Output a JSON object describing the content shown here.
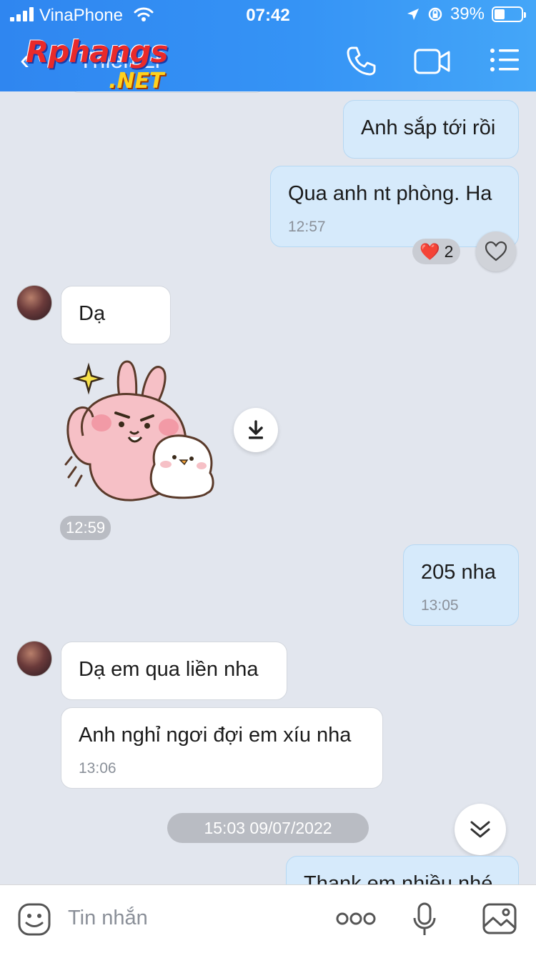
{
  "status_bar": {
    "carrier": "VinaPhone",
    "time": "07:42",
    "battery_percent": "39%",
    "battery_level": 0.39
  },
  "header": {
    "title": "Thiên Li",
    "logo_main": "Rphangs",
    "logo_sub": ".NET",
    "back_icon": "back-arrow-icon",
    "call_icon": "phone-icon",
    "video_icon": "video-camera-icon",
    "menu_icon": "menu-list-icon"
  },
  "messages": {
    "m1": {
      "text": "Anh sắp tới rồi"
    },
    "m2": {
      "text": "Qua anh nt phòng. Ha",
      "time": "12:57",
      "reaction_count": "2",
      "reaction_emoji": "❤️"
    },
    "m3": {
      "text": "Dạ"
    },
    "sticker_time": "12:59",
    "m4": {
      "text": "205 nha",
      "time": "13:05"
    },
    "m5": {
      "text": "Dạ em qua liền nha"
    },
    "m6": {
      "text": "Anh nghỉ ngơi đợi em xíu nha",
      "time": "13:06"
    },
    "date_separator": "15:03 09/07/2022",
    "m7": {
      "text": "Thank em nhiều nhé"
    }
  },
  "composer": {
    "placeholder": "Tin nhắn",
    "emoji_icon": "emoji-icon",
    "more_icon": "more-dots-icon",
    "mic_icon": "microphone-icon",
    "image_icon": "image-icon"
  },
  "colors": {
    "header_start": "#2f86f0",
    "header_end": "#44a6f8",
    "outgoing_bubble": "#d6eafb",
    "incoming_bubble": "#ffffff",
    "chat_bg": "#e2e6ee"
  }
}
